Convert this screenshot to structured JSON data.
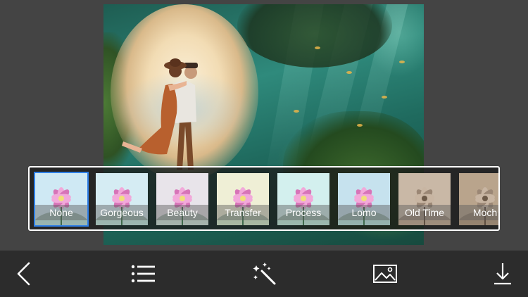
{
  "filters": [
    {
      "label": "None",
      "tint": "#cfe9f4",
      "selected": true
    },
    {
      "label": "Gorgeous",
      "tint": "#d5ecf3",
      "selected": false
    },
    {
      "label": "Beauty",
      "tint": "#e8e4ea",
      "selected": false
    },
    {
      "label": "Transfer",
      "tint": "#efefd6",
      "selected": false
    },
    {
      "label": "Process",
      "tint": "#d3f0ee",
      "selected": false
    },
    {
      "label": "Lomo",
      "tint": "#c6e2ee",
      "selected": false
    },
    {
      "label": "Old Time",
      "tint": "#c9b8a6",
      "selected": false
    },
    {
      "label": "Moch",
      "tint": "#b9a48c",
      "selected": false
    }
  ],
  "toolbar": {
    "back": "back-arrow-icon",
    "menu": "list-menu-icon",
    "effects": "magic-wand-icon",
    "gallery": "image-gallery-icon",
    "download": "download-icon"
  },
  "colors": {
    "background": "#444444",
    "toolbar": "#2c2c2c",
    "selection": "#2f7fe6",
    "strip_border": "#ffffff"
  }
}
